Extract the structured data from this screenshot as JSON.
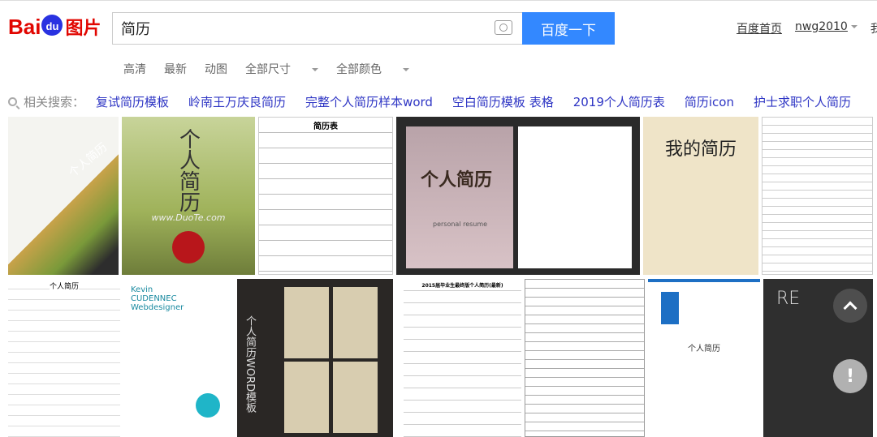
{
  "header": {
    "logo_text": "Bai du 图片",
    "search_value": "简历",
    "search_button": "百度一下",
    "links": [
      "百度首页",
      "nwg2010",
      "我"
    ]
  },
  "filters": [
    "高清",
    "最新",
    "动图",
    "全部尺寸",
    "全部颜色"
  ],
  "related": {
    "label": "相关搜索：",
    "items": [
      "复试简历模板",
      "岭南王万庆良简历",
      "完整个人简历样本word",
      "空白简历模板 表格",
      "2019个人简历表",
      "简历icon",
      "护士求职个人简历"
    ]
  },
  "images": {
    "r1": [
      "个人简历",
      "个人简历",
      "简历表",
      "个人简历",
      "我的简历",
      ""
    ],
    "r1_sub": [
      "",
      "www.DuoTe.com",
      "",
      "personal resume",
      "",
      "",
      ""
    ],
    "r2": [
      "个人简历",
      "Kevin CUDENNEC Webdesigner",
      "个人简历WORD模板",
      "2015届毕业生最终版个人简历(最新)",
      "",
      "个人简历",
      "RE"
    ]
  },
  "colors": {
    "accent": "#3388ff",
    "brand": "#e10601",
    "link": "#2e35c4"
  }
}
